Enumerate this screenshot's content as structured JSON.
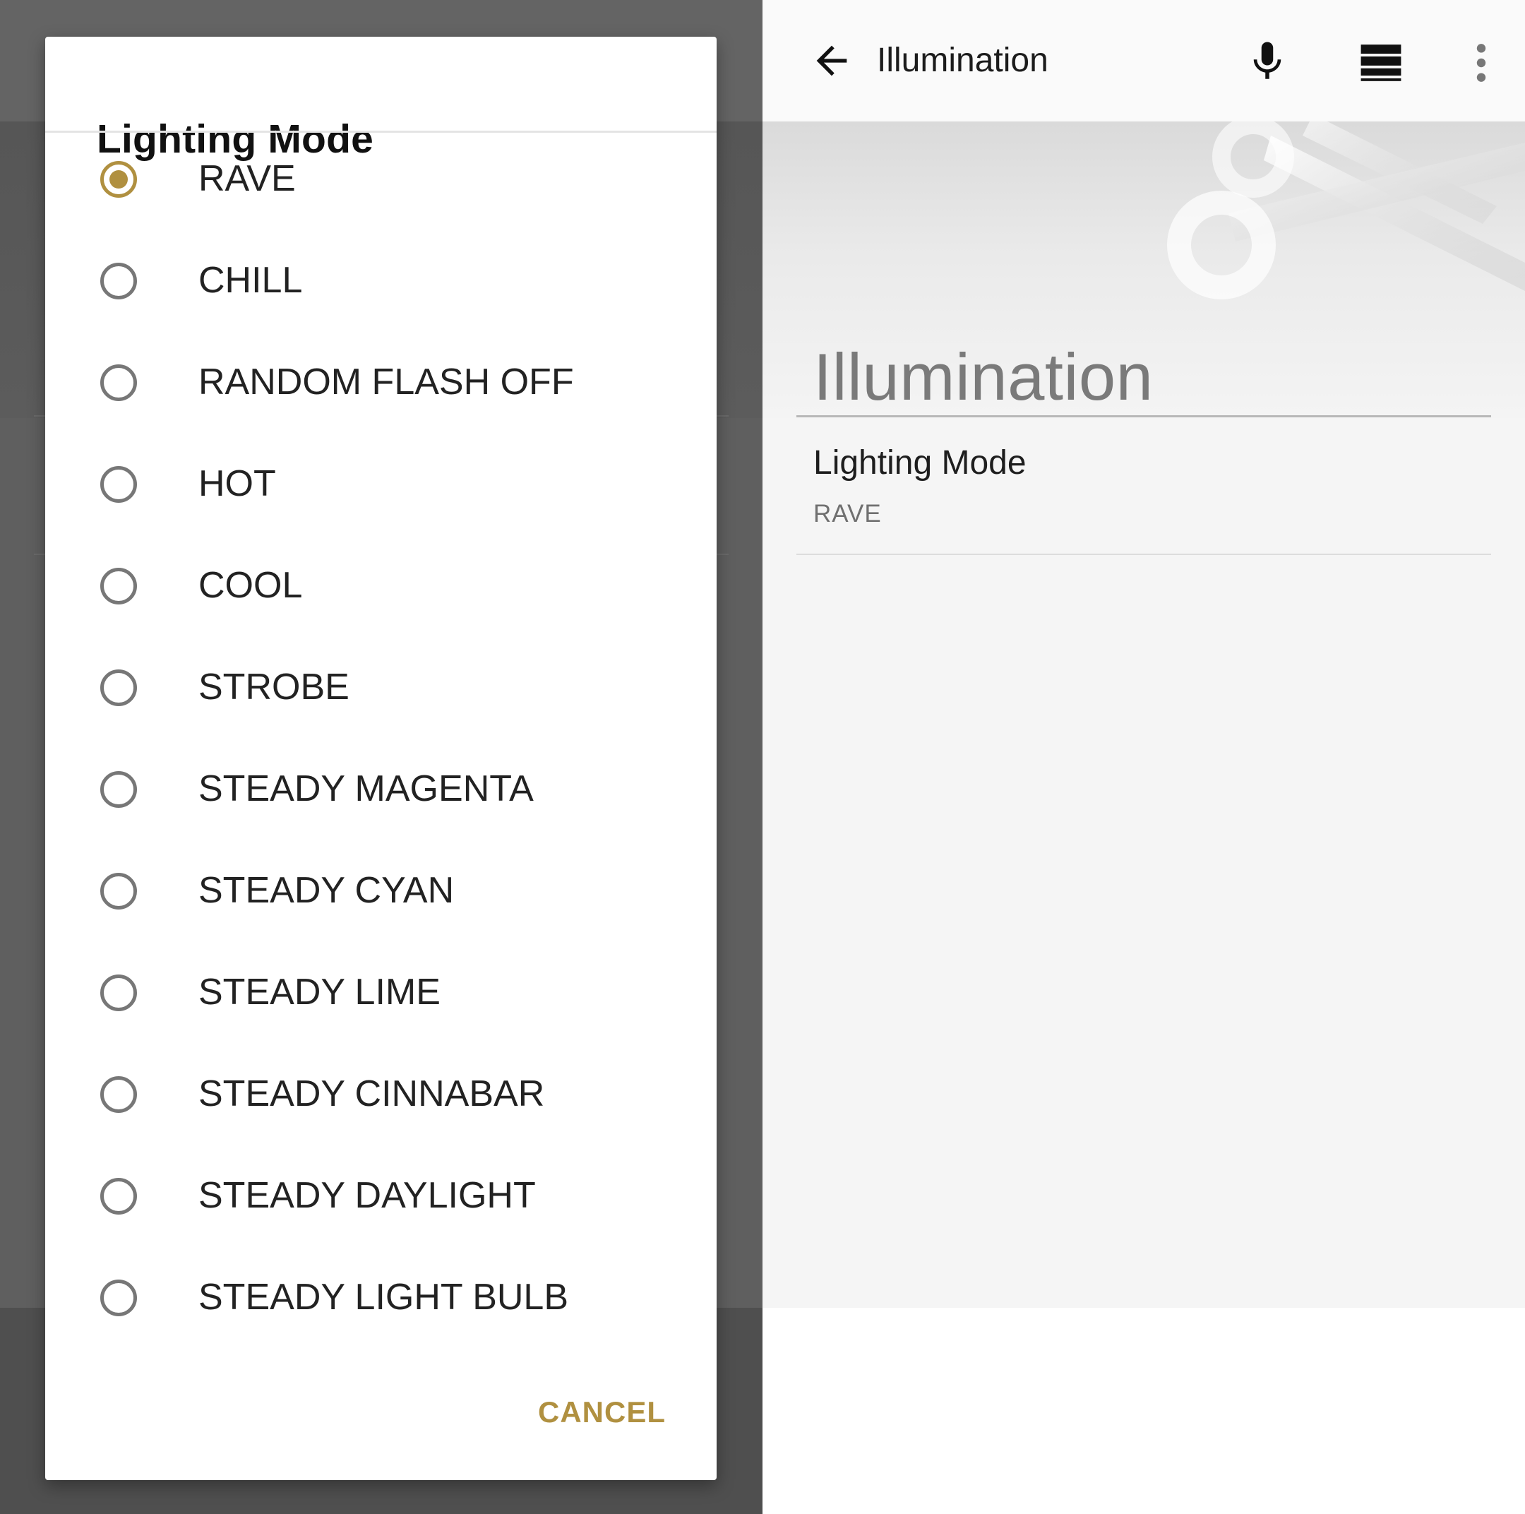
{
  "dialog": {
    "title": "Lighting Mode",
    "options": [
      {
        "label": "RAVE",
        "selected": true
      },
      {
        "label": "CHILL",
        "selected": false
      },
      {
        "label": "RANDOM FLASH OFF",
        "selected": false
      },
      {
        "label": "HOT",
        "selected": false
      },
      {
        "label": "COOL",
        "selected": false
      },
      {
        "label": "STROBE",
        "selected": false
      },
      {
        "label": "STEADY MAGENTA",
        "selected": false
      },
      {
        "label": "STEADY CYAN",
        "selected": false
      },
      {
        "label": "STEADY LIME",
        "selected": false
      },
      {
        "label": "STEADY CINNABAR",
        "selected": false
      },
      {
        "label": "STEADY DAYLIGHT",
        "selected": false
      },
      {
        "label": "STEADY LIGHT BULB",
        "selected": false
      }
    ],
    "cancel_label": "CANCEL"
  },
  "toolbar": {
    "title": "Illumination",
    "icons": [
      "back-arrow-icon",
      "microphone-icon",
      "layout-icon",
      "more-vert-icon"
    ]
  },
  "settings": {
    "section_title": "Illumination",
    "preferences": [
      {
        "title": "Lighting Mode",
        "summary": "RAVE"
      }
    ]
  },
  "colors": {
    "accent": "#b09040",
    "scrim": "#5f5f5f",
    "dialog_background": "#ffffff",
    "screen_background": "#f5f5f5"
  }
}
